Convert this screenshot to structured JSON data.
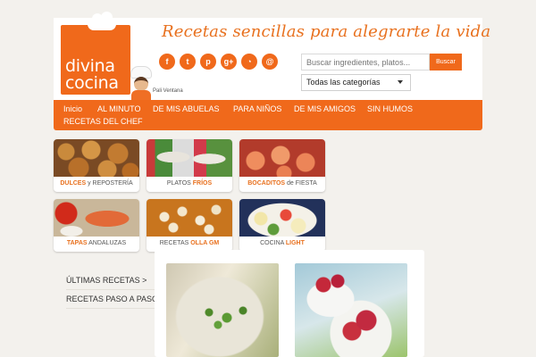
{
  "header": {
    "logo_line1": "divina",
    "logo_line2": "cocina",
    "chef_name": "Pali Ventana",
    "tagline": "Recetas sencillas para alegrarte la vida"
  },
  "social": [
    {
      "icon": "facebook-icon",
      "glyph": "f"
    },
    {
      "icon": "twitter-icon",
      "glyph": "t"
    },
    {
      "icon": "pinterest-icon",
      "glyph": "p"
    },
    {
      "icon": "google-plus-icon",
      "glyph": "g+"
    },
    {
      "icon": "rss-icon",
      "glyph": "◔"
    },
    {
      "icon": "email-icon",
      "glyph": "@"
    }
  ],
  "search": {
    "placeholder": "Buscar ingredientes, platos...",
    "button_label": "Buscar",
    "category_selected": "Todas las categorías"
  },
  "nav": {
    "items": [
      "Inicio",
      "AL MINUTO",
      "DE MIS ABUELAS",
      "PARA NIÑOS",
      "DE MIS AMIGOS",
      "SIN HUMOS",
      "RECETAS DEL CHEF"
    ]
  },
  "categories": [
    {
      "hl": "DULCES",
      "rest": " y REPOSTERÍA",
      "hl_first": true
    },
    {
      "pre": "PLATOS ",
      "hl": "FRÍOS",
      "hl_first": false
    },
    {
      "hl": "BOCADITOS",
      "rest": " de FIESTA",
      "hl_first": true
    },
    {
      "hl": "TAPAS",
      "rest": " ANDALUZAS",
      "hl_first": true
    },
    {
      "pre": "RECETAS ",
      "hl": "OLLA GM",
      "hl_first": false
    },
    {
      "pre": "COCINA ",
      "hl": "LIGHT",
      "hl_first": false
    }
  ],
  "sidebar": {
    "links": [
      "ÚLTIMAS RECETAS >",
      "RECETAS PASO A PASO >"
    ]
  },
  "colors": {
    "brand_orange": "#f0691b",
    "background": "#f3f1ed"
  }
}
